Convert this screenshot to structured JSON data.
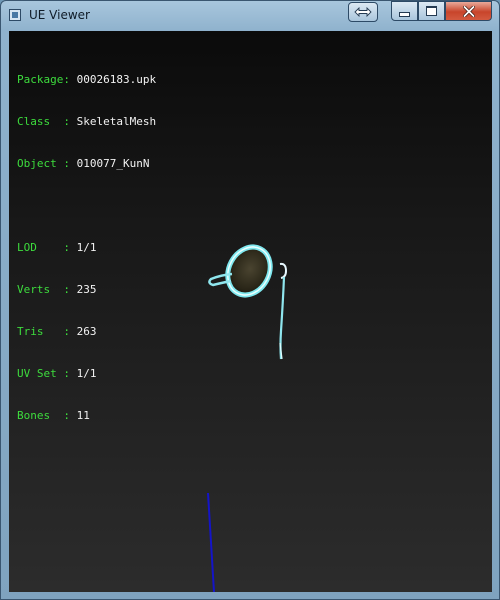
{
  "window": {
    "title": "UE Viewer",
    "icon": "app-icon",
    "controls": {
      "extra_icon": "resize-arrows-icon",
      "minimize_icon": "minimize-icon",
      "maximize_icon": "maximize-icon",
      "close_icon": "close-icon"
    }
  },
  "info": {
    "package_key": "Package:",
    "package_value": "00026183.upk",
    "class_key": "Class  :",
    "class_value": "SkeletalMesh",
    "object_key": "Object :",
    "object_value": "010077_KunN",
    "lod_key": "LOD    :",
    "lod_value": "1/1",
    "verts_key": "Verts  :",
    "verts_value": "235",
    "tris_key": "Tris   :",
    "tris_value": "263",
    "uvset_key": "UV Set :",
    "uvset_value": "1/1",
    "bones_key": "Bones  :",
    "bones_value": "11"
  },
  "colors": {
    "label_green": "#3ddc3d",
    "value_white": "#f2f2f2",
    "mesh_cyan": "#7fe8ef",
    "axis_blue": "#1414c8"
  }
}
